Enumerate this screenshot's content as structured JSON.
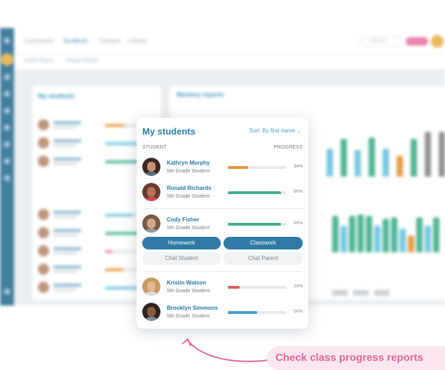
{
  "background_app": {
    "topbar_tabs": [
      "Curriculum",
      "Students",
      "Classes",
      "Library"
    ],
    "active_tab": "Students",
    "search_placeholder": "Search",
    "subnav": [
      "Student Reports",
      "Manage Students"
    ],
    "left_card_title": "My students",
    "right_card_title": "Mastery reports"
  },
  "card": {
    "title": "My students",
    "sort_label": "Sort: By first name",
    "col_student": "STUDENT",
    "col_progress": "PROGRESS",
    "students": [
      {
        "name": "Kathryn Murphy",
        "grade": "5th Grade Student",
        "progress_label": "34%",
        "progress": 34,
        "bar_color": "#e39431"
      },
      {
        "name": "Ronald Richards",
        "grade": "5th Grade Student",
        "progress_label": "90%",
        "progress": 90,
        "bar_color": "#3fae8c"
      },
      {
        "name": "Cody Fisher",
        "grade": "5th Grade Student",
        "progress_label": "90%",
        "progress": 90,
        "bar_color": "#3fae8c"
      },
      {
        "name": "Kristin Watson",
        "grade": "5th Grade Student",
        "progress_label": "20%",
        "progress": 20,
        "bar_color": "#e05a5a"
      },
      {
        "name": "Brooklyn Simmons",
        "grade": "5th Grade Student",
        "progress_label": "50%",
        "progress": 50,
        "bar_color": "#4a9bd1"
      }
    ],
    "actions": {
      "homework": "Homework",
      "classwork": "Classwork",
      "chat_student": "Chat Student",
      "chat_parent": "Chat Parent"
    }
  },
  "callout": {
    "text": "Check class progress reports"
  },
  "colors": {
    "primary": "#2f7aa6",
    "accent_pink": "#e0669d",
    "callout_bg": "#fbe6ef"
  }
}
